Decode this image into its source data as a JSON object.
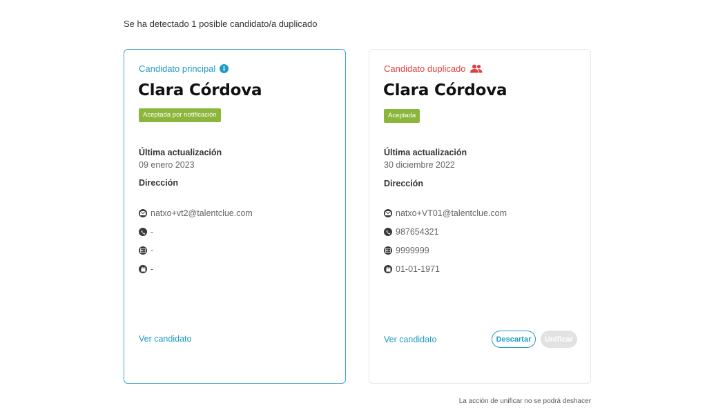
{
  "notice": "Se ha detectado 1 posible candidato/a duplicado",
  "main": {
    "heading": "Candidato principal",
    "name": "Clara Córdova",
    "badge": "Aceptada por notificación",
    "last_update_label": "Última actualización",
    "last_update_value": "09 enero 2023",
    "address_label": "Dirección",
    "email": "natxo+vt2@talentclue.com",
    "phone": "-",
    "id_doc": "-",
    "birthdate": "-",
    "view_link": "Ver candidato"
  },
  "duplicate": {
    "heading": "Candidato duplicado",
    "name": "Clara Córdova",
    "badge": "Aceptada",
    "last_update_label": "Última actualización",
    "last_update_value": "30 diciembre 2022",
    "address_label": "Dirección",
    "email": "natxo+VT01@talentclue.com",
    "phone": "987654321",
    "id_doc": "9999999",
    "birthdate": "01-01-1971",
    "view_link": "Ver candidato",
    "discard_label": "Descartar",
    "merge_label": "Unificar"
  },
  "footer_note": "La acción de unificar no se podrá deshacer",
  "colors": {
    "accent": "#1f9bc4",
    "duplicate": "#e0413f",
    "badge": "#8bb63c"
  },
  "icons": {
    "info": "info-icon",
    "duplicate": "users-icon",
    "email": "envelope-icon",
    "phone": "phone-icon",
    "id": "id-card-icon",
    "birthdate": "calendar-icon"
  }
}
